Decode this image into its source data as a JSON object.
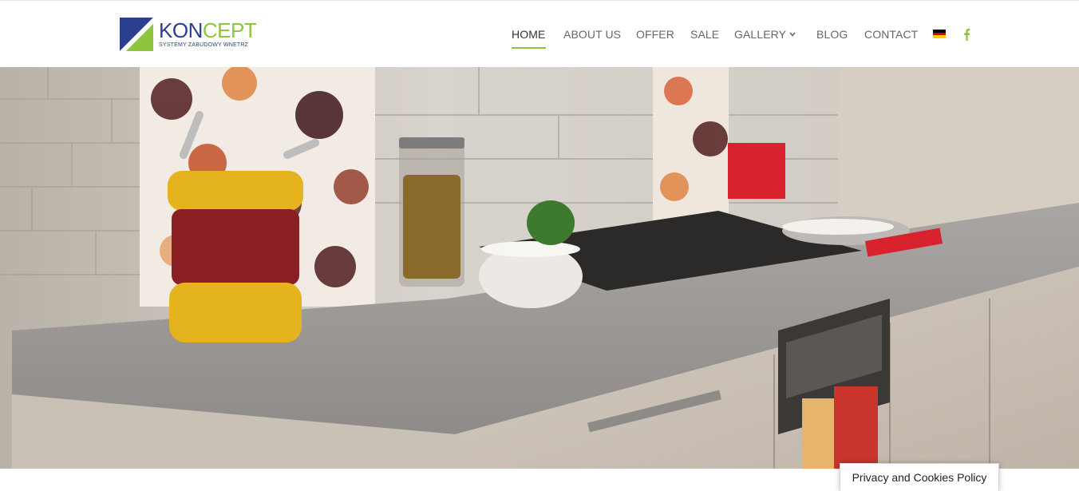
{
  "header": {
    "logo": {
      "brand_part1": "KON",
      "brand_part2": "CEPT",
      "tagline": "SYSTEMY ZABUDOWY WNETRZ"
    },
    "nav": {
      "home": "HOME",
      "about": "ABOUT US",
      "offer": "OFFER",
      "sale": "SALE",
      "gallery": "GALLERY",
      "blog": "BLOG",
      "contact": "CONTACT"
    },
    "language_icon": "german-flag-icon",
    "social_icon": "facebook-icon"
  },
  "colors": {
    "accent_green": "#8fc43e",
    "brand_blue": "#2a3f8e",
    "nav_text": "#666666"
  },
  "hero": {
    "image": "kitchen-countertop-photo"
  },
  "privacy_button": {
    "label": "Privacy and Cookies Policy"
  }
}
